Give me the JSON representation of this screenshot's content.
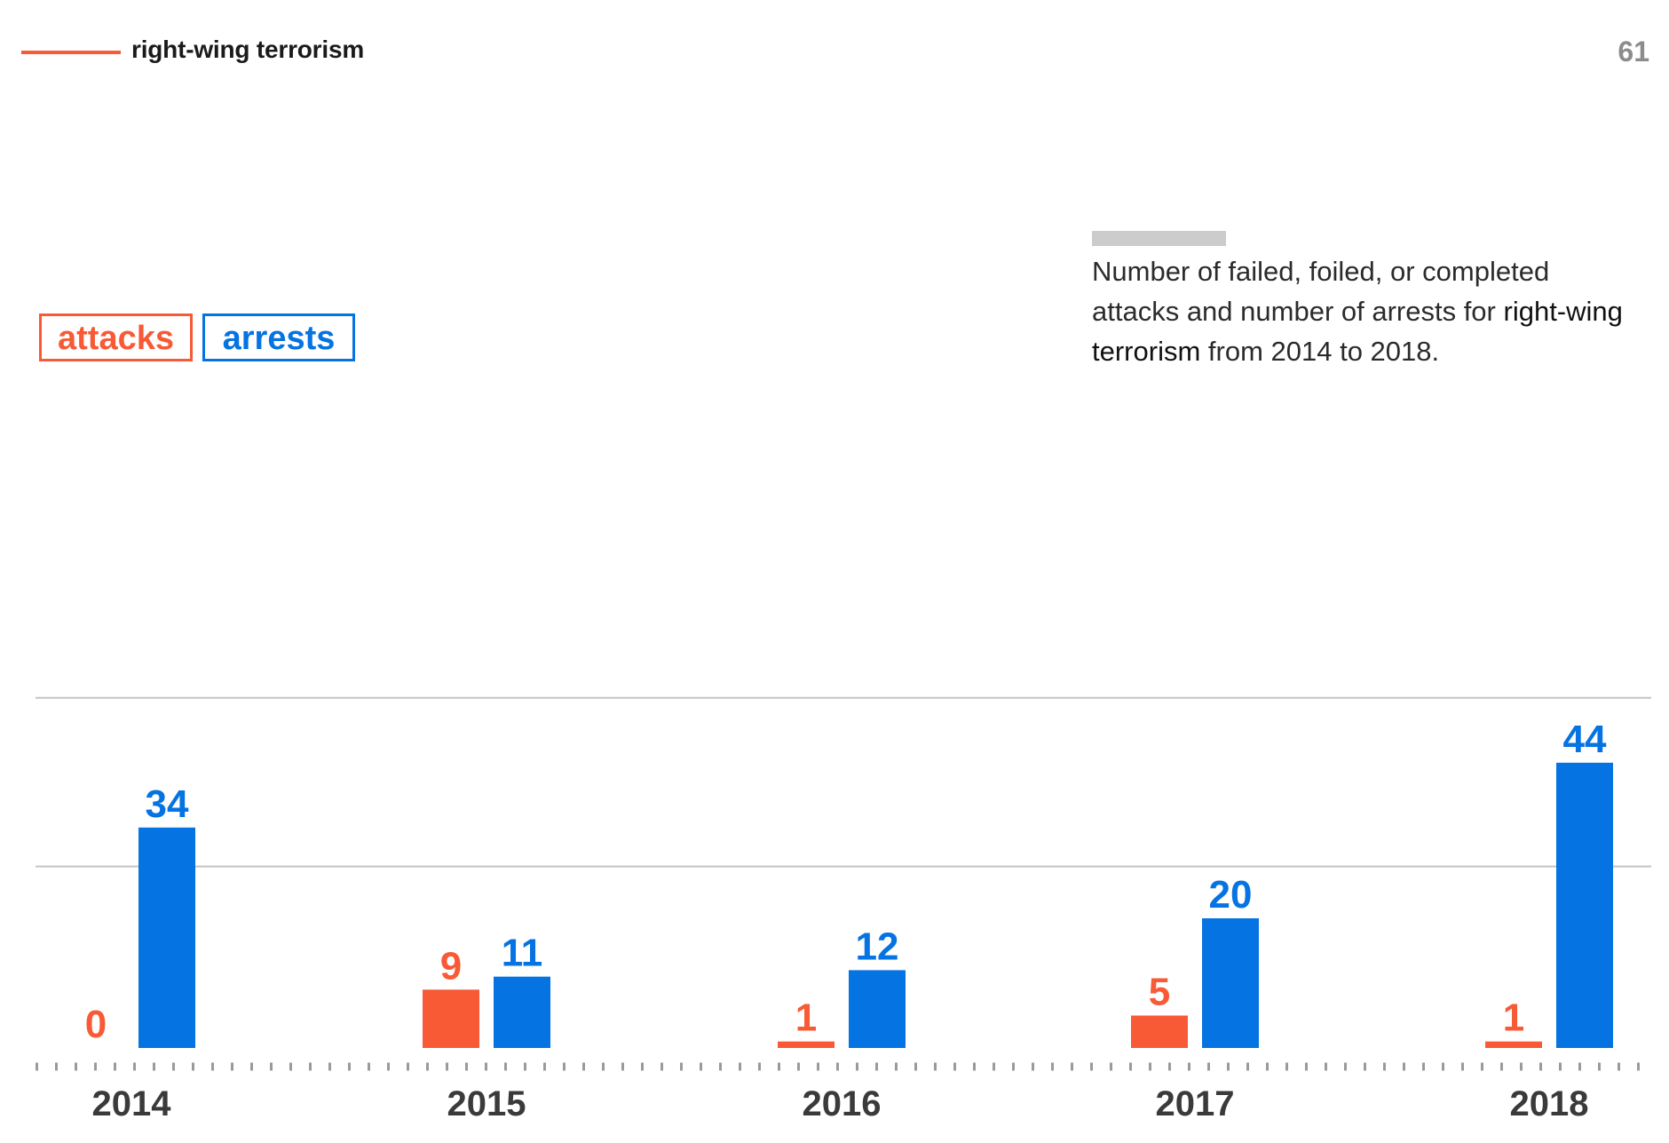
{
  "header": {
    "title": "right-wing terrorism",
    "page_number": "61"
  },
  "legend": {
    "attacks": "attacks",
    "arrests": "arrests"
  },
  "description": {
    "part1": "Number of failed, foiled, or completed attacks and number of arrests for ",
    "emphasis": "right-wing terrorism",
    "part2": " from 2014 to 2018."
  },
  "colors": {
    "attacks": "#f85a36",
    "arrests": "#0673e2",
    "gridline": "#c4c4c4",
    "description_rule": "#cccccc",
    "page_number": "#8c8c8c"
  },
  "chart_data": {
    "type": "bar",
    "categories": [
      "2014",
      "2015",
      "2016",
      "2017",
      "2018"
    ],
    "series": [
      {
        "name": "attacks",
        "values": [
          0,
          9,
          1,
          5,
          1
        ]
      },
      {
        "name": "arrests",
        "values": [
          34,
          11,
          12,
          20,
          44
        ]
      }
    ],
    "ylim": [
      0,
      54
    ],
    "gridlines": [
      28,
      54
    ],
    "grid": true,
    "legend_placement": "top-left",
    "data_labels": true
  }
}
